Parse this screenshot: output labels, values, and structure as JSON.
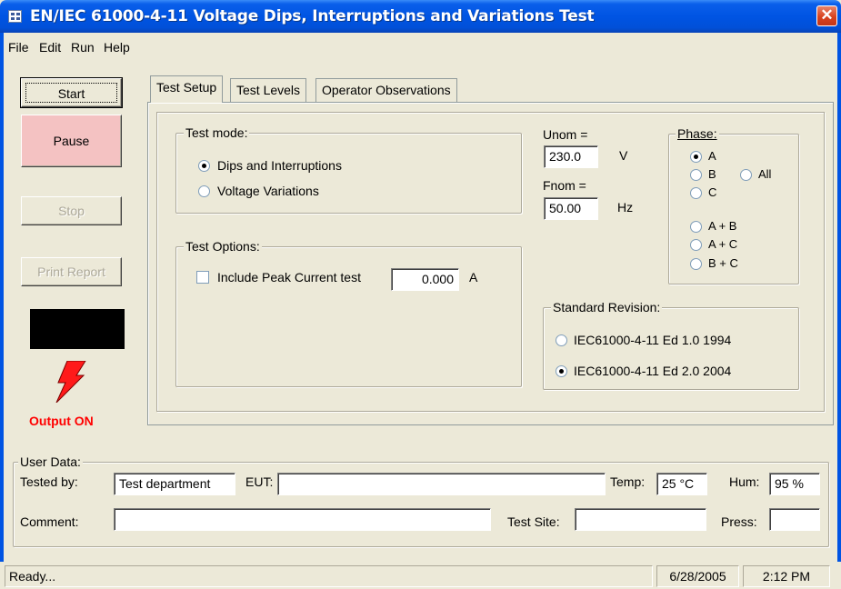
{
  "window": {
    "title": "EN/IEC 61000-4-11 Voltage Dips, Interruptions and Variations Test",
    "close_glyph": "✕"
  },
  "menu": [
    "File",
    "Edit",
    "Run",
    "Help"
  ],
  "controls": {
    "start": "Start",
    "pause": "Pause",
    "stop": "Stop",
    "print_report": "Print Report",
    "output_status": "Output ON",
    "pause_color": "#F4C2C2",
    "output_color": "#FF0000"
  },
  "tabs": [
    "Test Setup",
    "Test Levels",
    "Operator Observations"
  ],
  "test_setup": {
    "test_mode": {
      "title": "Test mode:",
      "options": [
        {
          "label": "Dips and Interruptions",
          "checked": true
        },
        {
          "label": "Voltage Variations",
          "checked": false
        }
      ]
    },
    "test_options": {
      "title": "Test Options:",
      "peak_current_label": "Include Peak Current test",
      "peak_current_checked": false,
      "peak_current_value": "0.000",
      "peak_current_unit": "A"
    },
    "unom_label": "Unom =",
    "unom_value": "230.0",
    "unom_unit": "V",
    "fnom_label": "Fnom =",
    "fnom_value": "50.00",
    "fnom_unit": "Hz",
    "phase": {
      "title": "Phase:",
      "options": [
        "A",
        "B",
        "All",
        "C",
        "A + B",
        "A + C",
        "B + C"
      ],
      "selected": "A"
    },
    "standard_revision": {
      "title": "Standard Revision:",
      "options": [
        {
          "label": "IEC61000-4-11 Ed 1.0 1994",
          "checked": false
        },
        {
          "label": "IEC61000-4-11 Ed 2.0 2004",
          "checked": true
        }
      ]
    }
  },
  "user_data": {
    "title": "User Data:",
    "tested_by_label": "Tested by:",
    "tested_by_value": "Test department",
    "eut_label": "EUT:",
    "eut_value": "",
    "temp_label": "Temp:",
    "temp_value": "25 °C",
    "hum_label": "Hum:",
    "hum_value": "95 %",
    "comment_label": "Comment:",
    "comment_value": "",
    "test_site_label": "Test Site:",
    "test_site_value": "",
    "press_label": "Press:",
    "press_value": ""
  },
  "status": {
    "message": "Ready...",
    "date": "6/28/2005",
    "time": "2:12 PM"
  }
}
